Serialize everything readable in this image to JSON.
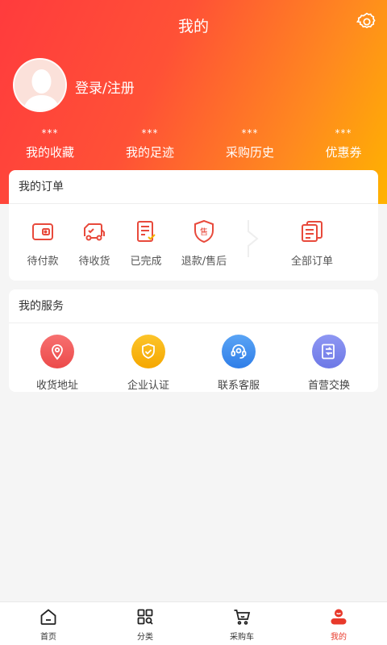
{
  "header": {
    "title": "我的"
  },
  "user": {
    "login_label": "登录/注册"
  },
  "stats": [
    {
      "value": "***",
      "label": "我的收藏"
    },
    {
      "value": "***",
      "label": "我的足迹"
    },
    {
      "value": "***",
      "label": "采购历史"
    },
    {
      "value": "***",
      "label": "优惠券"
    }
  ],
  "orders": {
    "title": "我的订单",
    "items": [
      {
        "label": "待付款",
        "icon": "wallet-icon"
      },
      {
        "label": "待收货",
        "icon": "truck-icon"
      },
      {
        "label": "已完成",
        "icon": "clipboard-check-icon"
      },
      {
        "label": "退款/售后",
        "icon": "shield-sell-icon"
      }
    ],
    "all_label": "全部订单"
  },
  "services": {
    "title": "我的服务",
    "items": [
      {
        "label": "收货地址",
        "icon": "location-pin-icon",
        "color": "#f05a5a"
      },
      {
        "label": "企业认证",
        "icon": "shield-check-icon",
        "color": "#fbb414"
      },
      {
        "label": "联系客服",
        "icon": "headset-icon",
        "color": "#3d8bef"
      },
      {
        "label": "首营交换",
        "icon": "exchange-doc-icon",
        "color": "#7b86ee"
      }
    ]
  },
  "tabbar": {
    "items": [
      {
        "label": "首页",
        "icon": "home-icon"
      },
      {
        "label": "分类",
        "icon": "category-icon"
      },
      {
        "label": "采购车",
        "icon": "cart-icon"
      },
      {
        "label": "我的",
        "icon": "profile-icon",
        "active": true
      }
    ]
  },
  "colors": {
    "accent": "#e8392b",
    "gradient_start": "#ff3b3d",
    "gradient_end": "#ffb300"
  }
}
